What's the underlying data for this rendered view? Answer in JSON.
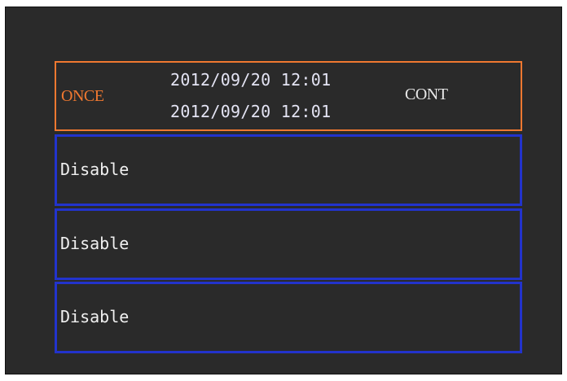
{
  "schedule": {
    "mode_left": "ONCE",
    "start_datetime": "2012/09/20 12:01",
    "end_datetime": "2012/09/20 12:01",
    "mode_right": "CONT"
  },
  "slots": [
    {
      "status": "Disable"
    },
    {
      "status": "Disable"
    },
    {
      "status": "Disable"
    }
  ],
  "colors": {
    "background": "#2a2a2a",
    "selected_border": "#f07830",
    "slot_border": "#2233cc",
    "selected_text": "#f07830",
    "text": "#f0f0f0"
  }
}
